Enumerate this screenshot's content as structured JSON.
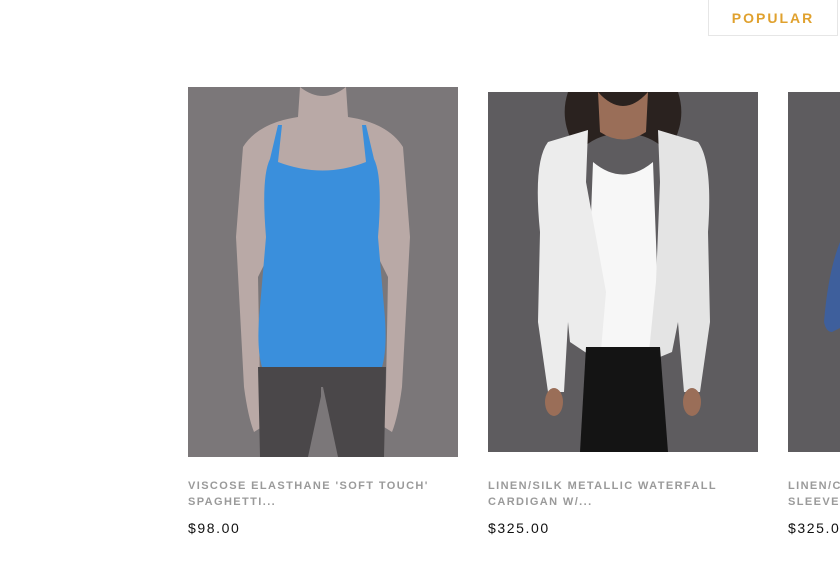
{
  "tabs": {
    "popular": "POPULAR"
  },
  "products": [
    {
      "title_line1": "VISCOSE ELASTHANE 'SOFT TOUCH'",
      "title_line2": "SPAGHETTI...",
      "price": "$98.00",
      "image": "blue-camisole-photo"
    },
    {
      "title_line1": "LINEN/SILK METALLIC WATERFALL",
      "title_line2": "CARDIGAN W/...",
      "price": "$325.00",
      "image": "white-cardigan-photo"
    },
    {
      "title_line1": "LINEN/C",
      "title_line2": "SLEEVE I",
      "price": "$325.0",
      "image": "blue-top-photo"
    }
  ],
  "colors": {
    "accent": "#e0a12e",
    "photo_bg": "#7a7679",
    "camisole": "#3a8fdc",
    "cardigan": "#f3f3f3"
  }
}
